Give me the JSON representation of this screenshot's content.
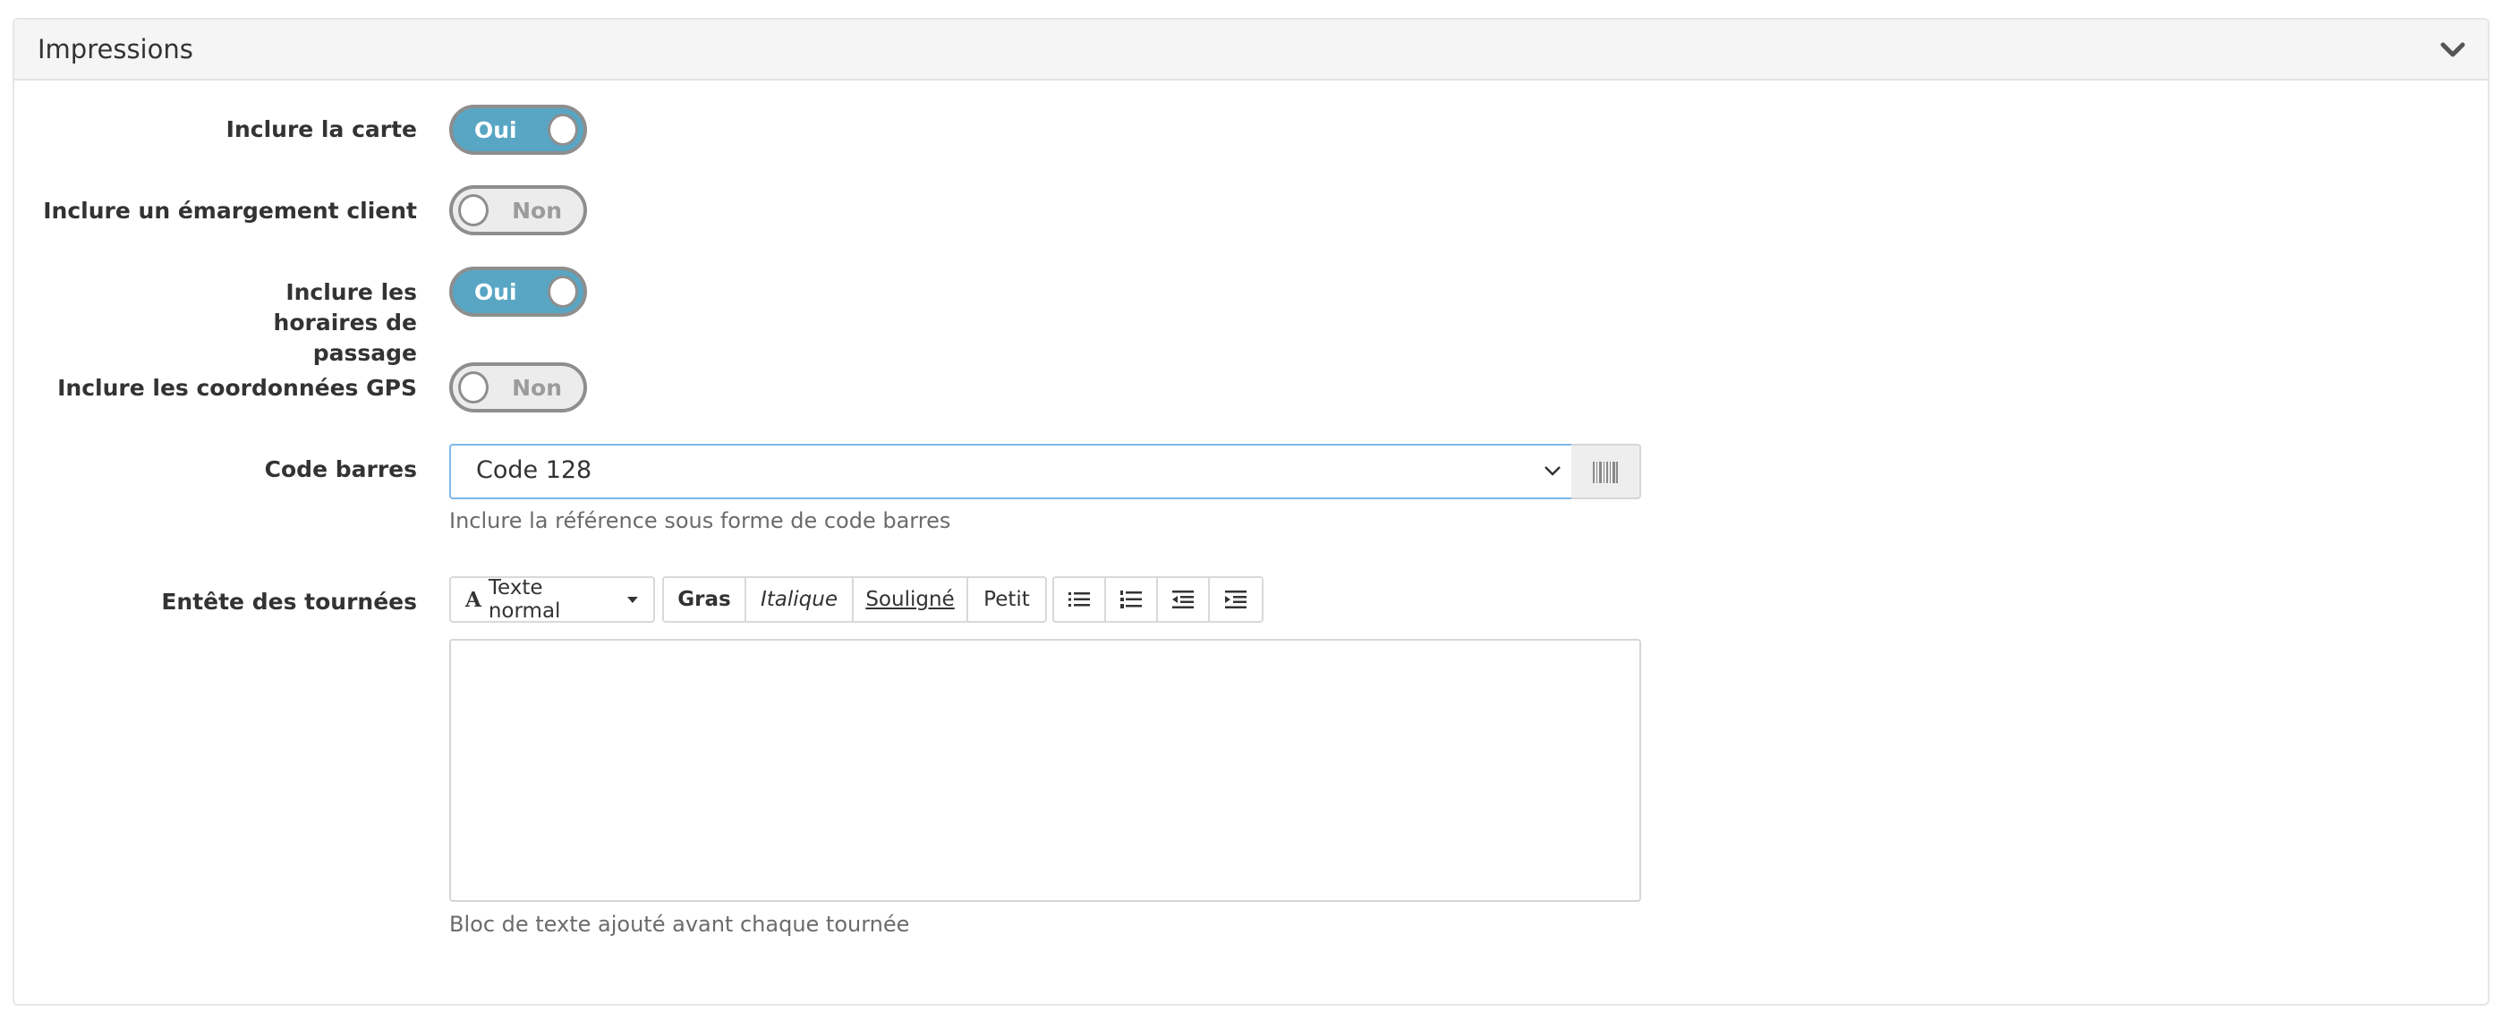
{
  "panel": {
    "title": "Impressions",
    "collapse_icon": "chevron-down-icon"
  },
  "form": {
    "include_map": {
      "label": "Inclure la carte",
      "value": "Oui",
      "state": true
    },
    "include_signature": {
      "label": "Inclure un émargement client",
      "value": "Non",
      "state": false
    },
    "include_schedule": {
      "label": "Inclure les horaires de passage",
      "value": "Oui",
      "state": true
    },
    "include_gps": {
      "label": "Inclure les coordonnées GPS",
      "value": "Non",
      "state": false
    },
    "barcode": {
      "label": "Code barres",
      "selected": "Code 128",
      "help": "Inclure la référence sous forme de code barres",
      "addon_icon": "barcode-icon"
    },
    "tour_header": {
      "label": "Entête des tournées",
      "help": "Bloc de texte ajouté avant chaque tournée",
      "toolbar": {
        "style_dropdown": "Texte normal",
        "bold": "Gras",
        "italic": "Italique",
        "underline": "Souligné",
        "small": "Petit",
        "list_icons": [
          "unordered-list-icon",
          "ordered-list-icon",
          "outdent-icon",
          "indent-icon"
        ]
      },
      "content": ""
    }
  },
  "colors": {
    "toggle_on": "#58a6c4",
    "toggle_off": "#ececec",
    "focus_border": "#7fb6e8"
  }
}
